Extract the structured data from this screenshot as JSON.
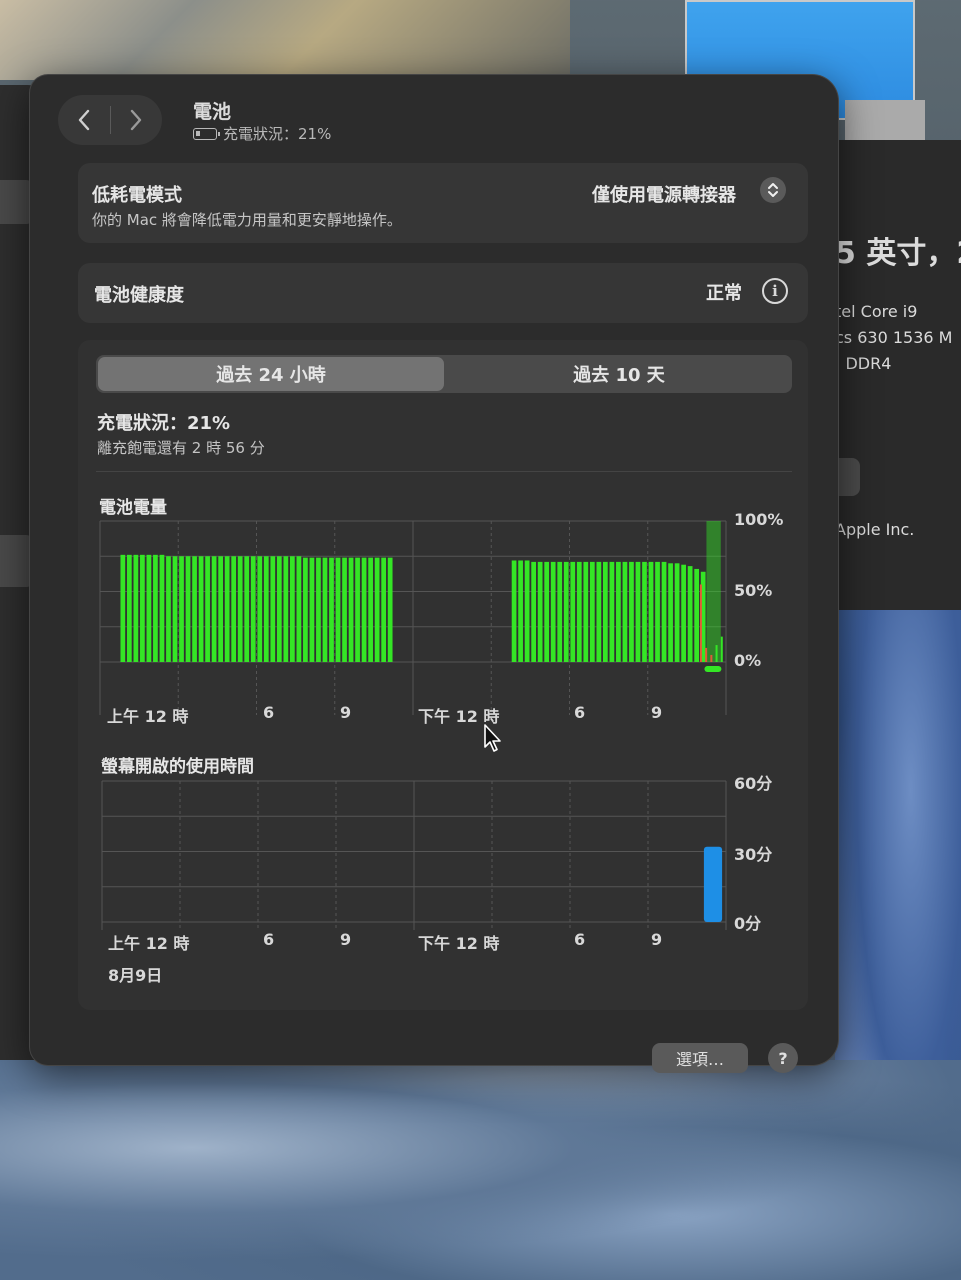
{
  "background": {
    "right_panel_lines": [
      "5 英寸，2",
      "tel Core i9",
      "cs 630 1536 M",
      ": DDR4",
      "Apple Inc."
    ]
  },
  "window": {
    "nav": {
      "back_icon": "chevron-left-icon",
      "forward_icon": "chevron-right-icon"
    },
    "title": "電池",
    "subtitle": "充電狀況：21%",
    "low_power": {
      "title": "低耗電模式",
      "description": "你的 Mac 將會降低電力用量和更安靜地操作。",
      "value": "僅使用電源轉接器"
    },
    "health": {
      "title": "電池健康度",
      "value": "正常",
      "info_icon": "i"
    },
    "tabs": [
      {
        "label": "過去 24 小時",
        "active": true
      },
      {
        "label": "過去 10 天",
        "active": false
      }
    ],
    "status": {
      "title": "充電狀況：21%",
      "subtitle": "離充飽電還有 2 時 56 分"
    },
    "buttons": {
      "options": "選項…",
      "help": "?"
    },
    "colors": {
      "battery_bar": "#34e625",
      "battery_low": "#e05a3a",
      "usage_bar": "#1e8fe6",
      "window_bg": "#2c2c2c"
    }
  },
  "chart_data": [
    {
      "type": "bar",
      "title": "電池電量",
      "x_ticks": [
        "上午 12 時",
        "6",
        "9",
        "下午 12 時",
        "6",
        "9"
      ],
      "y_ticks": [
        "100%",
        "50%",
        "0%"
      ],
      "ylim": [
        0,
        100
      ],
      "slot_count": 96,
      "segments": [
        {
          "start": 3,
          "end": 41,
          "values": [
            76,
            76,
            76,
            76,
            76,
            76,
            76,
            75,
            75,
            75,
            75,
            75,
            75,
            75,
            75,
            75,
            75,
            75,
            75,
            75,
            75,
            75,
            75,
            75,
            75,
            75,
            75,
            75,
            74,
            74,
            74,
            74,
            74,
            74,
            74,
            74,
            74,
            74,
            74,
            74,
            74,
            74
          ]
        },
        {
          "start": 63,
          "end": 92,
          "values": [
            72,
            72,
            72,
            71,
            71,
            71,
            71,
            71,
            71,
            71,
            71,
            71,
            71,
            71,
            71,
            71,
            71,
            71,
            71,
            71,
            71,
            71,
            71,
            71,
            70,
            70,
            69,
            68,
            66,
            64
          ]
        }
      ],
      "tail": {
        "low_values": [
          55,
          10,
          5,
          12,
          18
        ],
        "charging_overlay": true
      },
      "grid": true
    },
    {
      "type": "bar",
      "title": "螢幕開啟的使用時間",
      "x_ticks": [
        "上午 12 時",
        "6",
        "9",
        "下午 12 時",
        "6",
        "9"
      ],
      "date_label": "8月9日",
      "y_ticks": [
        "60分",
        "30分",
        "0分"
      ],
      "ylim": [
        0,
        60
      ],
      "slot_count": 24,
      "values": [
        0,
        0,
        0,
        0,
        0,
        0,
        0,
        0,
        0,
        0,
        0,
        0,
        0,
        0,
        0,
        0,
        0,
        0,
        0,
        0,
        0,
        0,
        0,
        32
      ],
      "grid": true
    }
  ]
}
